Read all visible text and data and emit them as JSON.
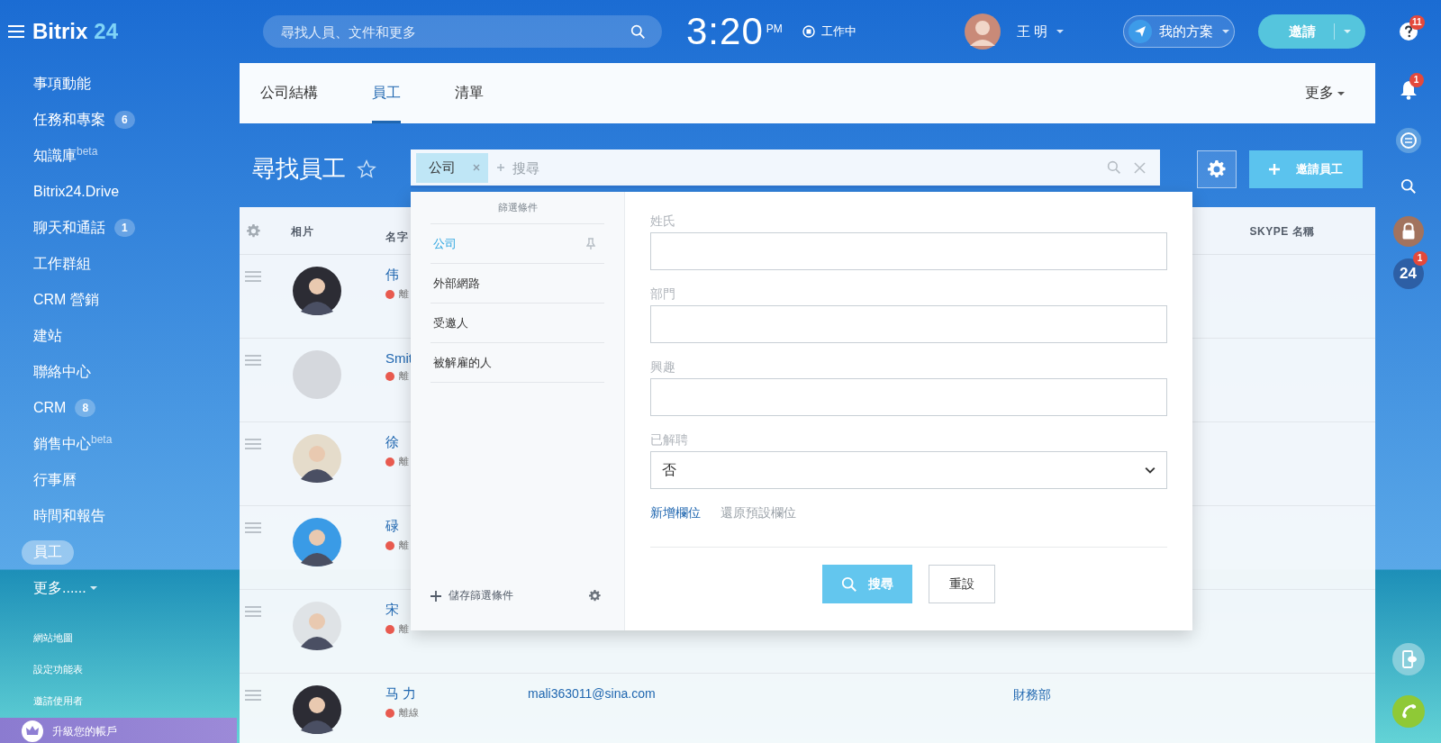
{
  "header": {
    "logo": "Bitrix",
    "logo_number": "24",
    "search_placeholder": "尋找人員、文件和更多",
    "time": "3:20",
    "time_suffix": "PM",
    "work_status": "工作中",
    "user_name": "王 明",
    "plan_button": "我的方案",
    "invite_button": "邀請",
    "help_badge": "11"
  },
  "sidebar": {
    "items": [
      {
        "label": "事項動能",
        "kind": "link",
        "selected": false
      },
      {
        "label": "任務和專案",
        "counter": "6",
        "kind": "link",
        "selected": false
      },
      {
        "label": "知識庫$^{beta}$",
        "kind": "link",
        "selected": false
      },
      {
        "label": "Bitrix24.Drive",
        "kind": "link",
        "selected": false
      },
      {
        "label": "聊天和通話",
        "counter": "1",
        "kind": "link",
        "selected": false
      },
      {
        "label": "工作群組",
        "kind": "link",
        "selected": false
      },
      {
        "label": "CRM 營銷",
        "kind": "link",
        "selected": false
      },
      {
        "label": "建站",
        "kind": "link",
        "selected": false
      },
      {
        "label": "聯絡中心",
        "kind": "link",
        "selected": false
      },
      {
        "label": "CRM",
        "counter": "8",
        "kind": "link",
        "selected": false
      },
      {
        "label": "銷售中心$^{beta}$",
        "kind": "link",
        "selected": false
      },
      {
        "label": "行事曆",
        "kind": "link",
        "selected": false
      },
      {
        "label": "時間和報告",
        "kind": "link",
        "selected": false
      },
      {
        "label": "員工",
        "kind": "link",
        "selected": true
      },
      {
        "label": "更多......",
        "kind": "menu",
        "selected": false
      }
    ],
    "links": [
      "網站地圖",
      "設定功能表",
      "邀請使用者"
    ],
    "upgrade": "升級您的帳戶"
  },
  "tabs": [
    {
      "label": "公司結構",
      "selected": false
    },
    {
      "label": "員工",
      "selected": true
    },
    {
      "label": "清單",
      "selected": false
    }
  ],
  "tabs_more": "更多",
  "page": {
    "title": "尋找員工",
    "invite_button": "邀請員工"
  },
  "filter": {
    "tag": "公司",
    "placeholder": "搜尋",
    "heading": "篩選條件",
    "presets": [
      {
        "label": "公司",
        "selected": true,
        "pinned": true
      },
      {
        "label": "外部網路",
        "selected": false,
        "pinned": false
      },
      {
        "label": "受邀人",
        "selected": false,
        "pinned": false
      },
      {
        "label": "被解雇的人",
        "selected": false,
        "pinned": false
      }
    ],
    "save_preset": "儲存篩選條件",
    "fields": [
      {
        "label": "姓氏",
        "kind": "text"
      },
      {
        "label": "部門",
        "kind": "text"
      },
      {
        "label": "興趣",
        "kind": "text"
      },
      {
        "label": "已解聘",
        "kind": "select",
        "value": "否"
      }
    ],
    "add_field": "新增欄位",
    "restore_fields": "還原預設欄位",
    "search_button": "搜尋",
    "reset_button": "重設"
  },
  "table": {
    "columns": [
      {
        "label": "相片",
        "kind": "photo"
      },
      {
        "label": "名字",
        "kind": "name"
      },
      {
        "label": "SKYPE 名稱",
        "kind": "skype"
      }
    ],
    "rows": [
      {
        "kind": "photo",
        "name": "伟",
        "status": "離"
      },
      {
        "kind": "blank",
        "name": "Smit",
        "status": "離"
      },
      {
        "kind": "photo",
        "name": "徐",
        "status": "離"
      },
      {
        "kind": "photo",
        "name": "碌",
        "status": "離"
      },
      {
        "kind": "photo",
        "name": "宋",
        "status": "離"
      },
      {
        "kind": "photo",
        "name": "马 力",
        "status": "離線",
        "email": "mali363011@sina.com",
        "department": "財務部"
      }
    ]
  },
  "right_rail": {
    "notifications_badge": "1",
    "apps_label": "24",
    "apps_badge": "1"
  }
}
